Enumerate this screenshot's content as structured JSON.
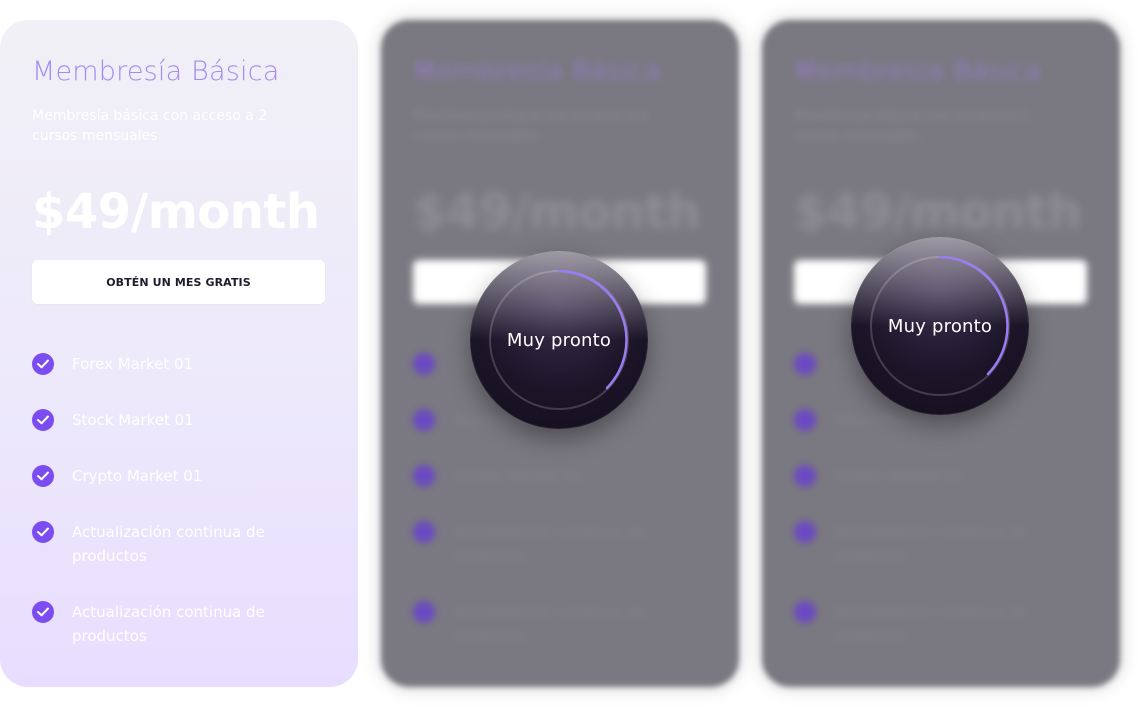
{
  "plans": [
    {
      "title": "Membresía Básica",
      "description": "Membresía básica con acceso a 2 cursos mensuales",
      "price": "$49/month",
      "cta_label": "OBTÉN UN MES GRATIS",
      "features": [
        "Forex Market 01",
        "Stock Market 01",
        "Crypto Market 01",
        "Actualización continua de productos",
        "Actualización continua de productos"
      ]
    }
  ],
  "locked_badge": {
    "label": "Muy pronto"
  },
  "colors": {
    "accent": "#7b4cf0",
    "title": "#a48af2",
    "badge_bg": "#1c1528"
  }
}
